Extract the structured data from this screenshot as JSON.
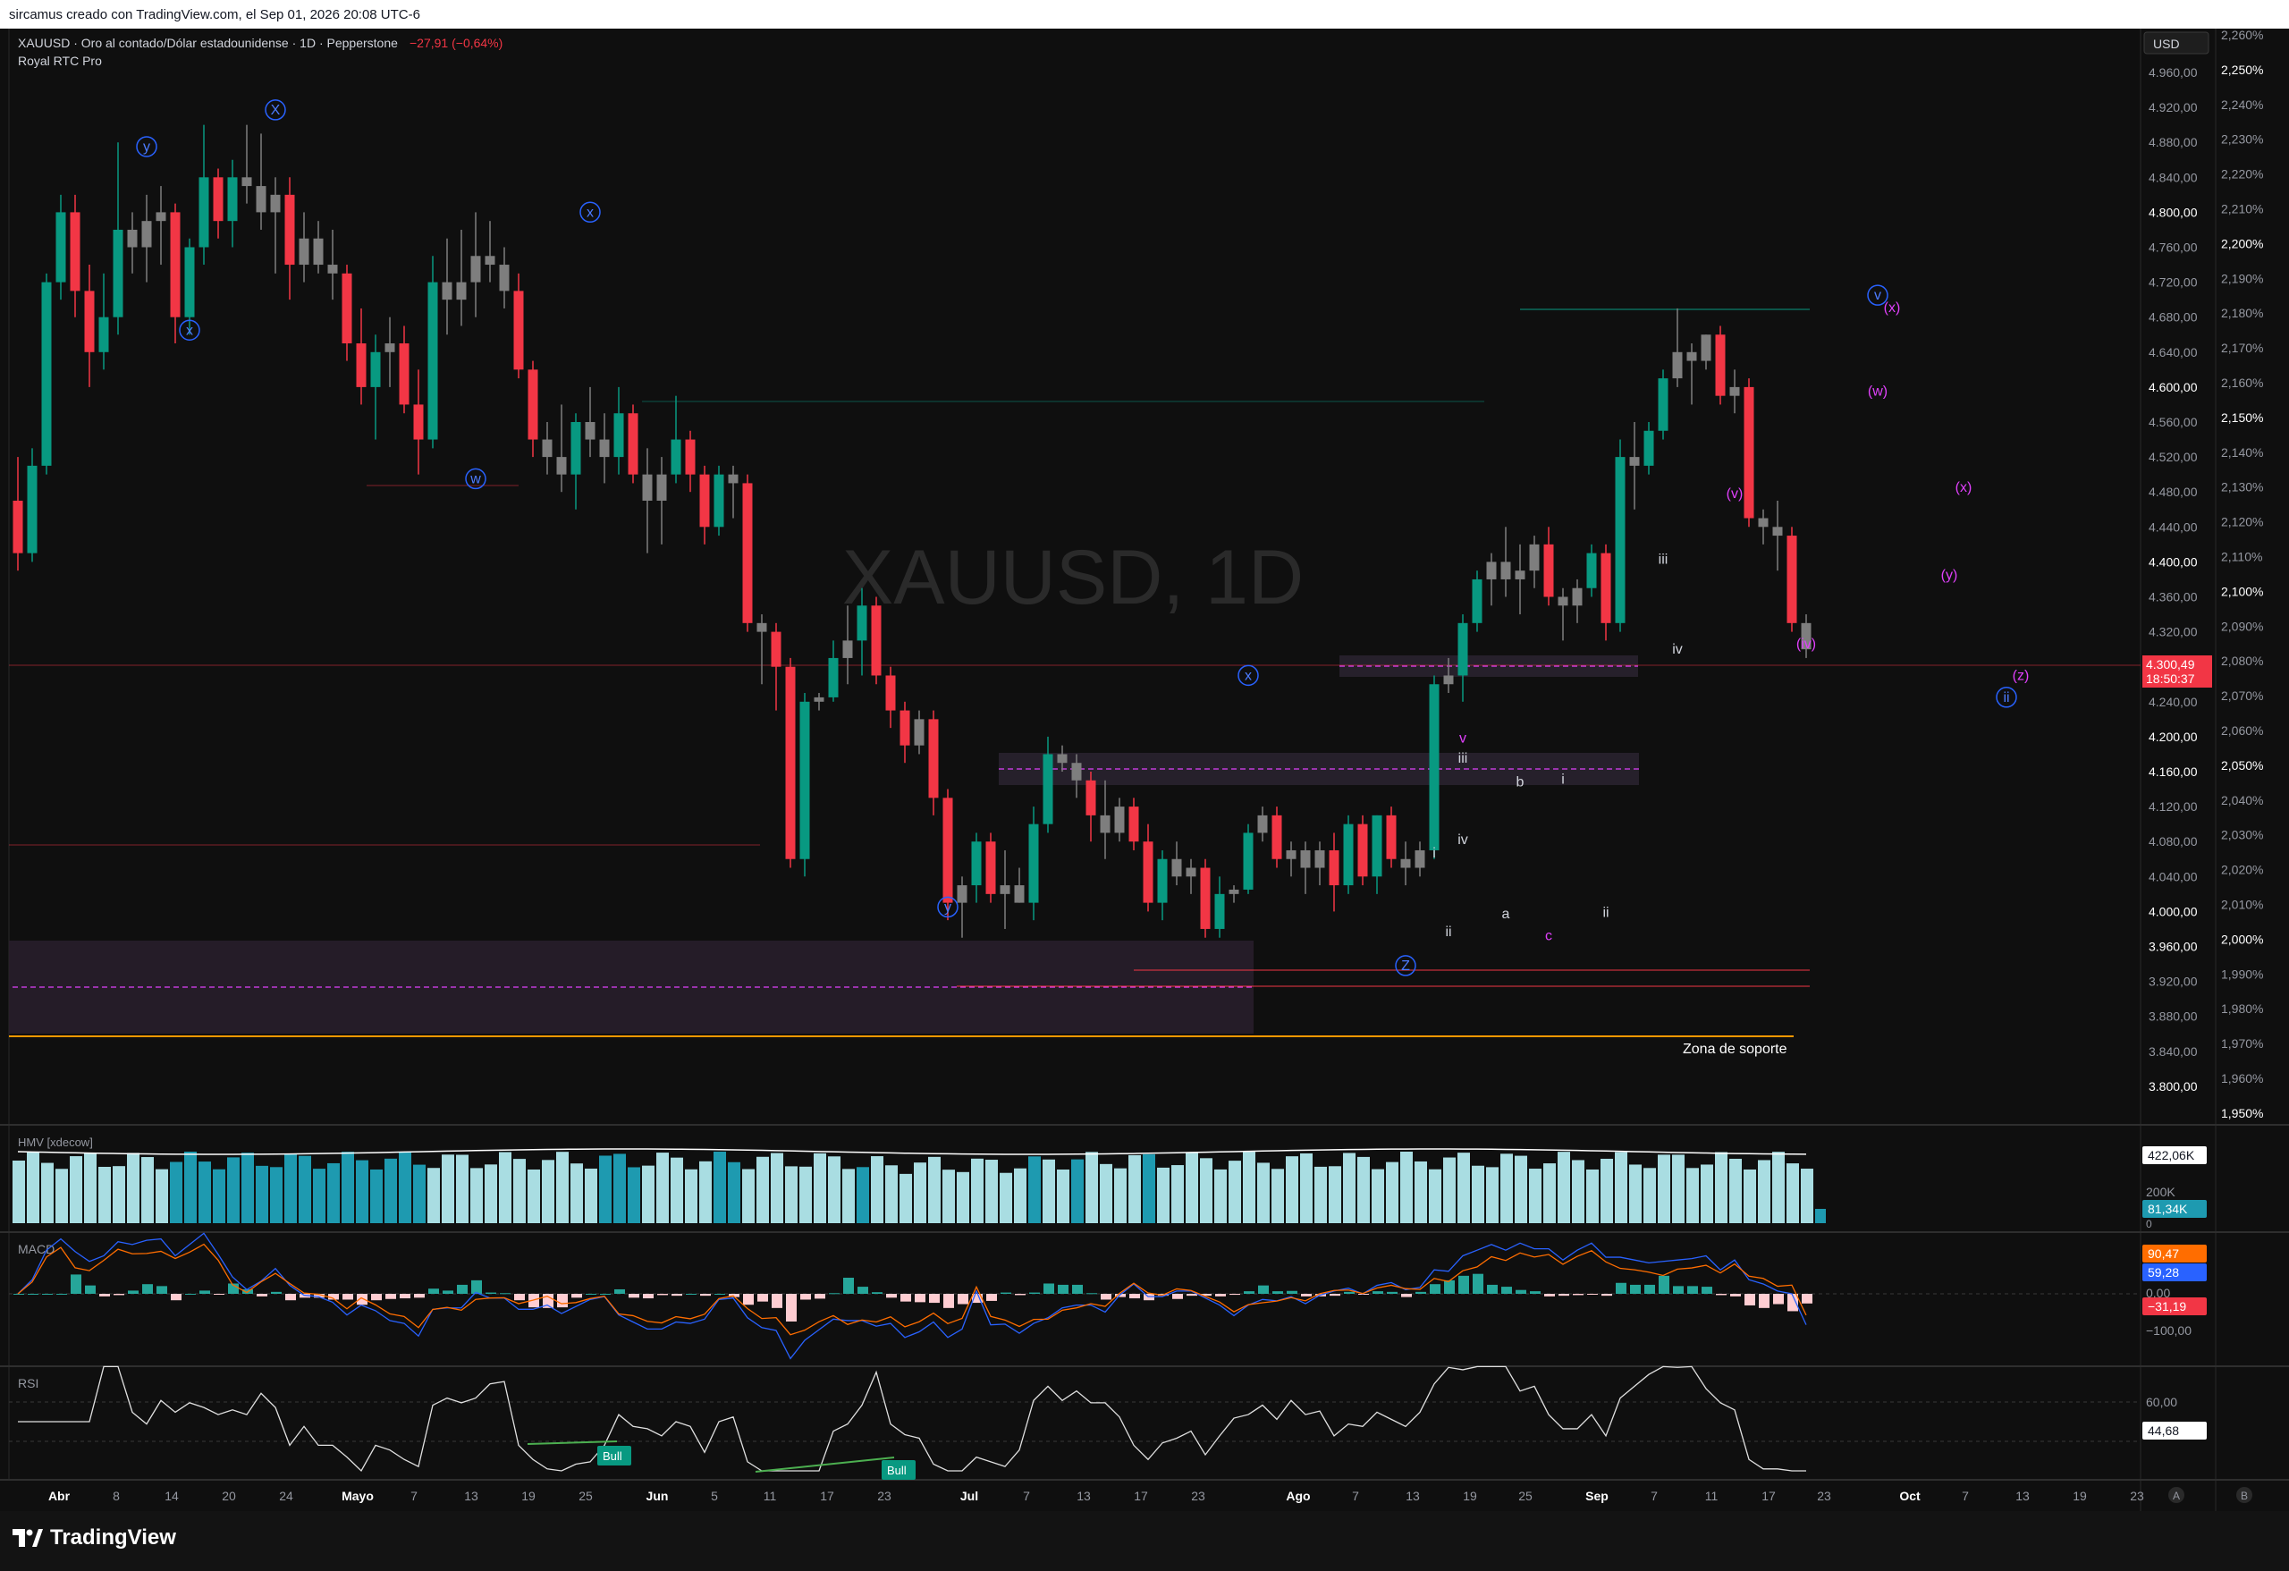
{
  "header": {
    "caption": "sircamus creado con TradingView.com, el Sep 01, 2026 20:08 UTC-6"
  },
  "chart_info": {
    "title": "XAUUSD · Oro al contado/Dólar estadounidense · 1D · Pepperstone",
    "change": "−27,91 (−0,64%)",
    "indicator": "Royal RTC Pro",
    "watermark": "XAUUSD, 1D",
    "currency": "USD"
  },
  "price_axis": {
    "left_labels": [
      "4.960,00",
      "4.920,00",
      "4.880,00",
      "4.840,00",
      "4.800,00",
      "4.760,00",
      "4.720,00",
      "4.680,00",
      "4.640,00",
      "4.600,00",
      "4.560,00",
      "4.520,00",
      "4.480,00",
      "4.440,00",
      "4.400,00",
      "4.360,00",
      "4.320,00",
      "4.240,00",
      "4.200,00",
      "4.160,00",
      "4.120,00",
      "4.080,00",
      "4.040,00",
      "4.000,00",
      "3.960,00",
      "3.920,00",
      "3.880,00",
      "3.840,00",
      "3.800,00"
    ],
    "right_labels": [
      "2,260%",
      "2,250%",
      "2,240%",
      "2,230%",
      "2,220%",
      "2,210%",
      "2,200%",
      "2,190%",
      "2,180%",
      "2,170%",
      "2,160%",
      "2,150%",
      "2,140%",
      "2,130%",
      "2,120%",
      "2,110%",
      "2,100%",
      "2,090%",
      "2,080%",
      "2,070%",
      "2,060%",
      "2,050%",
      "2,040%",
      "2,030%",
      "2,020%",
      "2,010%",
      "2,000%",
      "1,990%",
      "1,980%",
      "1,970%",
      "1,960%",
      "1,950%"
    ],
    "current_price": "4.300,49",
    "countdown": "18:50:37"
  },
  "chart_data": {
    "type": "candlestick",
    "symbol": "XAUUSD",
    "interval": "1D",
    "ylim": [
      3790,
      4995
    ],
    "x_ticks": [
      "Abr",
      "8",
      "14",
      "20",
      "24",
      "Mayo",
      "7",
      "13",
      "19",
      "25",
      "Jun",
      "5",
      "11",
      "17",
      "23",
      "Jul",
      "7",
      "13",
      "17",
      "23",
      "Ago",
      "7",
      "13",
      "19",
      "25",
      "Sep",
      "7",
      "11",
      "17",
      "23",
      "Oct",
      "7",
      "13",
      "19",
      "23"
    ],
    "ohlc": [
      [
        4470,
        4520,
        4390,
        4410
      ],
      [
        4410,
        4530,
        4400,
        4510
      ],
      [
        4510,
        4730,
        4500,
        4720
      ],
      [
        4720,
        4820,
        4700,
        4800
      ],
      [
        4800,
        4820,
        4680,
        4710
      ],
      [
        4710,
        4740,
        4600,
        4640
      ],
      [
        4640,
        4730,
        4620,
        4680
      ],
      [
        4680,
        4880,
        4660,
        4780
      ],
      [
        4780,
        4800,
        4730,
        4760
      ],
      [
        4760,
        4820,
        4720,
        4790
      ],
      [
        4790,
        4830,
        4740,
        4800
      ],
      [
        4800,
        4810,
        4650,
        4680
      ],
      [
        4680,
        4770,
        4660,
        4760
      ],
      [
        4760,
        4900,
        4740,
        4840
      ],
      [
        4840,
        4850,
        4770,
        4790
      ],
      [
        4790,
        4860,
        4760,
        4840
      ],
      [
        4840,
        4900,
        4810,
        4830
      ],
      [
        4830,
        4890,
        4780,
        4800
      ],
      [
        4800,
        4840,
        4730,
        4820
      ],
      [
        4820,
        4840,
        4700,
        4740
      ],
      [
        4740,
        4800,
        4720,
        4770
      ],
      [
        4770,
        4790,
        4730,
        4740
      ],
      [
        4740,
        4780,
        4700,
        4730
      ],
      [
        4730,
        4740,
        4630,
        4650
      ],
      [
        4650,
        4690,
        4580,
        4600
      ],
      [
        4600,
        4660,
        4540,
        4640
      ],
      [
        4640,
        4680,
        4600,
        4650
      ],
      [
        4650,
        4670,
        4570,
        4580
      ],
      [
        4580,
        4620,
        4500,
        4540
      ],
      [
        4540,
        4750,
        4530,
        4720
      ],
      [
        4720,
        4770,
        4660,
        4700
      ],
      [
        4700,
        4780,
        4670,
        4720
      ],
      [
        4720,
        4800,
        4680,
        4750
      ],
      [
        4750,
        4790,
        4720,
        4740
      ],
      [
        4740,
        4760,
        4690,
        4710
      ],
      [
        4710,
        4730,
        4610,
        4620
      ],
      [
        4620,
        4630,
        4520,
        4540
      ],
      [
        4540,
        4560,
        4500,
        4520
      ],
      [
        4520,
        4580,
        4480,
        4500
      ],
      [
        4500,
        4570,
        4460,
        4560
      ],
      [
        4560,
        4600,
        4520,
        4540
      ],
      [
        4540,
        4570,
        4490,
        4520
      ],
      [
        4520,
        4600,
        4500,
        4570
      ],
      [
        4570,
        4580,
        4490,
        4500
      ],
      [
        4500,
        4530,
        4410,
        4470
      ],
      [
        4470,
        4520,
        4420,
        4500
      ],
      [
        4500,
        4590,
        4490,
        4540
      ],
      [
        4540,
        4550,
        4480,
        4500
      ],
      [
        4500,
        4510,
        4420,
        4440
      ],
      [
        4440,
        4510,
        4430,
        4500
      ],
      [
        4500,
        4510,
        4450,
        4490
      ],
      [
        4490,
        4500,
        4320,
        4330
      ],
      [
        4330,
        4340,
        4260,
        4320
      ],
      [
        4320,
        4330,
        4230,
        4280
      ],
      [
        4280,
        4290,
        4050,
        4060
      ],
      [
        4060,
        4250,
        4040,
        4240
      ],
      [
        4240,
        4250,
        4230,
        4245
      ],
      [
        4245,
        4310,
        4240,
        4290
      ],
      [
        4290,
        4350,
        4260,
        4310
      ],
      [
        4310,
        4370,
        4270,
        4350
      ],
      [
        4350,
        4360,
        4260,
        4270
      ],
      [
        4270,
        4280,
        4210,
        4230
      ],
      [
        4230,
        4240,
        4170,
        4190
      ],
      [
        4190,
        4230,
        4180,
        4220
      ],
      [
        4220,
        4230,
        4110,
        4130
      ],
      [
        4130,
        4140,
        3990,
        4010
      ],
      [
        4010,
        4040,
        3970,
        4030
      ],
      [
        4030,
        4090,
        4010,
        4080
      ],
      [
        4080,
        4090,
        4010,
        4020
      ],
      [
        4020,
        4070,
        3980,
        4030
      ],
      [
        4030,
        4050,
        4010,
        4010
      ],
      [
        4010,
        4120,
        3990,
        4100
      ],
      [
        4100,
        4200,
        4090,
        4180
      ],
      [
        4180,
        4190,
        4160,
        4170
      ],
      [
        4170,
        4180,
        4130,
        4150
      ],
      [
        4150,
        4160,
        4080,
        4110
      ],
      [
        4110,
        4150,
        4060,
        4090
      ],
      [
        4090,
        4130,
        4080,
        4120
      ],
      [
        4120,
        4130,
        4070,
        4080
      ],
      [
        4080,
        4100,
        4000,
        4010
      ],
      [
        4010,
        4070,
        3990,
        4060
      ],
      [
        4060,
        4080,
        4030,
        4040
      ],
      [
        4040,
        4060,
        4020,
        4050
      ],
      [
        4050,
        4060,
        3970,
        3980
      ],
      [
        3980,
        4040,
        3970,
        4020
      ],
      [
        4020,
        4030,
        4010,
        4025
      ],
      [
        4025,
        4100,
        4020,
        4090
      ],
      [
        4090,
        4120,
        4080,
        4110
      ],
      [
        4110,
        4120,
        4050,
        4060
      ],
      [
        4060,
        4080,
        4040,
        4070
      ],
      [
        4070,
        4080,
        4020,
        4050
      ],
      [
        4050,
        4080,
        4030,
        4070
      ],
      [
        4070,
        4090,
        4000,
        4030
      ],
      [
        4030,
        4110,
        4020,
        4100
      ],
      [
        4100,
        4110,
        4030,
        4040
      ],
      [
        4040,
        4110,
        4020,
        4110
      ],
      [
        4110,
        4120,
        4050,
        4060
      ],
      [
        4060,
        4080,
        4030,
        4050
      ],
      [
        4050,
        4080,
        4040,
        4070
      ],
      [
        4070,
        4270,
        4060,
        4260
      ],
      [
        4260,
        4290,
        4250,
        4270
      ],
      [
        4270,
        4340,
        4240,
        4330
      ],
      [
        4330,
        4390,
        4320,
        4380
      ],
      [
        4380,
        4410,
        4350,
        4400
      ],
      [
        4400,
        4440,
        4360,
        4380
      ],
      [
        4380,
        4420,
        4340,
        4390
      ],
      [
        4390,
        4430,
        4370,
        4420
      ],
      [
        4420,
        4440,
        4350,
        4360
      ],
      [
        4360,
        4370,
        4310,
        4350
      ],
      [
        4350,
        4380,
        4330,
        4370
      ],
      [
        4370,
        4420,
        4360,
        4410
      ],
      [
        4410,
        4420,
        4310,
        4330
      ],
      [
        4330,
        4540,
        4320,
        4520
      ],
      [
        4520,
        4560,
        4460,
        4510
      ],
      [
        4510,
        4560,
        4500,
        4550
      ],
      [
        4550,
        4620,
        4540,
        4610
      ],
      [
        4610,
        4690,
        4600,
        4640
      ],
      [
        4640,
        4650,
        4580,
        4630
      ],
      [
        4630,
        4660,
        4620,
        4660
      ],
      [
        4660,
        4670,
        4580,
        4590
      ],
      [
        4590,
        4620,
        4570,
        4600
      ],
      [
        4600,
        4610,
        4440,
        4450
      ],
      [
        4450,
        4460,
        4420,
        4440
      ],
      [
        4440,
        4470,
        4390,
        4430
      ],
      [
        4430,
        4440,
        4320,
        4330
      ],
      [
        4330,
        4340,
        4290,
        4300
      ]
    ],
    "levels": [
      {
        "name": "Zona de soporte",
        "value": 3885,
        "color": "#ff9800"
      }
    ],
    "wave_labels": [
      {
        "text": "X",
        "i": 18,
        "p": 4912,
        "style": "blue-circle"
      },
      {
        "text": "y",
        "i": 9,
        "p": 4870,
        "style": "blue-circle"
      },
      {
        "text": "x",
        "i": 12,
        "p": 4660,
        "style": "blue-circle"
      },
      {
        "text": "x",
        "i": 40,
        "p": 4795,
        "style": "blue-circle"
      },
      {
        "text": "w",
        "i": 32,
        "p": 4490,
        "style": "blue-circle"
      },
      {
        "text": "y",
        "i": 65,
        "p": 4000,
        "style": "blue-circle"
      },
      {
        "text": "x",
        "i": 86,
        "p": 4265,
        "style": "blue-circle"
      },
      {
        "text": "Z",
        "i": 97,
        "p": 3933,
        "style": "blue-circle"
      },
      {
        "text": "v",
        "i": 130,
        "p": 4700,
        "style": "blue-circle"
      },
      {
        "text": "ii",
        "i": 139,
        "p": 4240,
        "style": "blue-circle"
      },
      {
        "text": "(x)",
        "i": 131,
        "p": 4686,
        "style": "magenta"
      },
      {
        "text": "(w)",
        "i": 130,
        "p": 4590,
        "style": "magenta"
      },
      {
        "text": "(x)",
        "i": 136,
        "p": 4480,
        "style": "magenta"
      },
      {
        "text": "(y)",
        "i": 135,
        "p": 4380,
        "style": "magenta"
      },
      {
        "text": "(v)",
        "i": 120,
        "p": 4473,
        "style": "magenta"
      },
      {
        "text": "(iv)",
        "i": 125,
        "p": 4301,
        "style": "magenta"
      },
      {
        "text": "(z)",
        "i": 140,
        "p": 4265,
        "style": "magenta"
      },
      {
        "text": "v",
        "i": 101,
        "p": 4193,
        "style": "magenta"
      },
      {
        "text": "c",
        "i": 107,
        "p": 3967,
        "style": "magenta"
      },
      {
        "text": "iii",
        "i": 115,
        "p": 4398,
        "style": "white"
      },
      {
        "text": "iv",
        "i": 116,
        "p": 4295,
        "style": "white"
      },
      {
        "text": "iii",
        "i": 101,
        "p": 4170,
        "style": "white"
      },
      {
        "text": "iv",
        "i": 101,
        "p": 4077,
        "style": "white"
      },
      {
        "text": "b",
        "i": 105,
        "p": 4143,
        "style": "white"
      },
      {
        "text": "i",
        "i": 108,
        "p": 4146,
        "style": "white"
      },
      {
        "text": "i",
        "i": 99,
        "p": 4062,
        "style": "white"
      },
      {
        "text": "a",
        "i": 104,
        "p": 3992,
        "style": "white"
      },
      {
        "text": "ii",
        "i": 100,
        "p": 3972,
        "style": "white"
      },
      {
        "text": "ii",
        "i": 111,
        "p": 3994,
        "style": "white"
      }
    ]
  },
  "volume_panel": {
    "label": "HMV [xdecow]",
    "values": [
      "422,06K",
      "200K",
      "81,34K",
      "0"
    ]
  },
  "macd_panel": {
    "label": "MACD",
    "values": [
      "90,47",
      "59,28",
      "0,00",
      "−31,19",
      "−100,00"
    ]
  },
  "rsi_panel": {
    "label": "RSI",
    "values": [
      "60,00",
      "44,68"
    ],
    "signals": [
      "Bull",
      "Bull"
    ]
  },
  "time_axis": {
    "buttons": [
      "A",
      "B"
    ]
  },
  "footer": {
    "brand": "TradingView"
  },
  "colors": {
    "up": "#089981",
    "down": "#f23645",
    "neutral": "#7e7e7e",
    "background": "#0f0f0f",
    "wave_blue": "#2962ff",
    "wave_magenta": "#e040fb"
  }
}
